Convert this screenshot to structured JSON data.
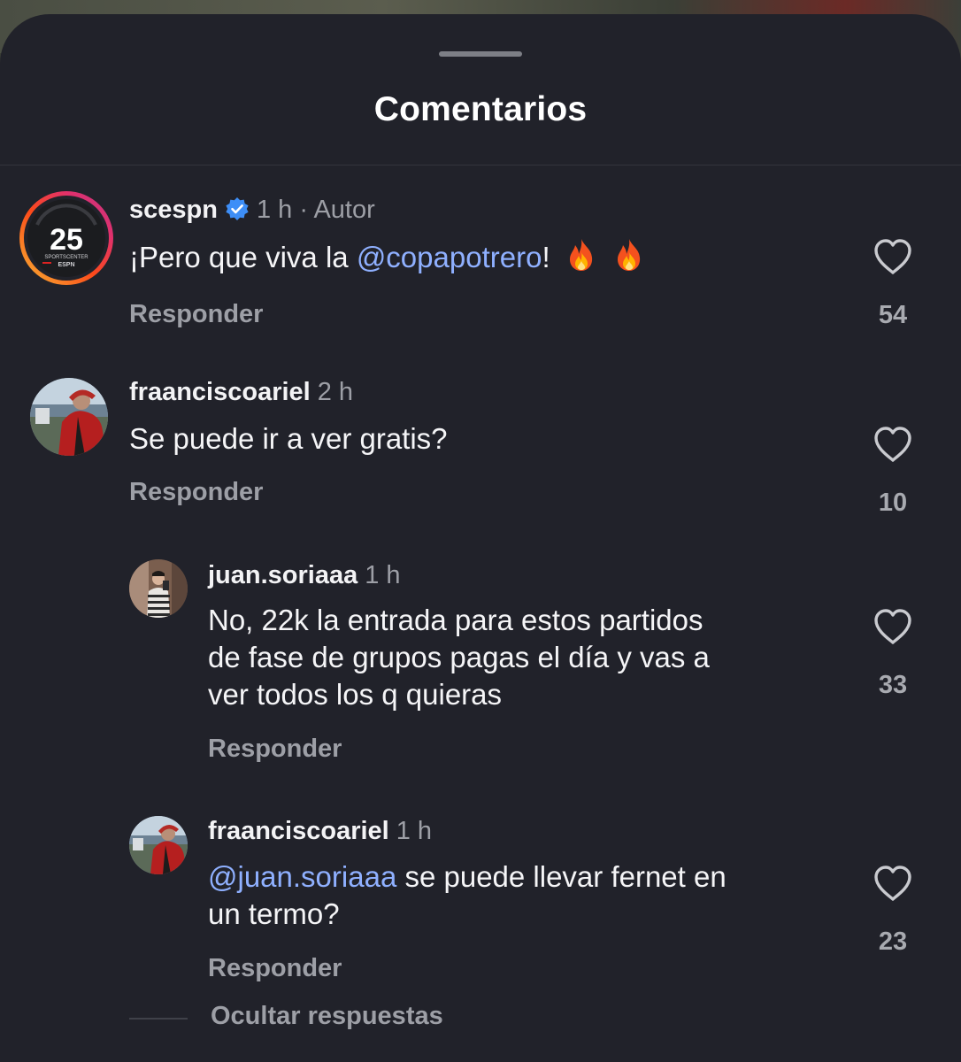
{
  "sheet": {
    "title": "Comentarios",
    "hide_replies_label": "Ocultar respuestas"
  },
  "comments": [
    {
      "username": "scespn",
      "verified": true,
      "time": "1 h",
      "author_tag": "· Autor",
      "text_prefix": "¡Pero que viva la ",
      "mention": "@copapotrero",
      "text_suffix": "!",
      "emojis": [
        "fire-emoji",
        "fire-emoji"
      ],
      "reply_label": "Responder",
      "likes": "54",
      "avatar": "sportscenter-25-logo"
    },
    {
      "username": "fraanciscoariel",
      "time": "2 h",
      "text": "Se puede ir a ver gratis?",
      "reply_label": "Responder",
      "likes": "10",
      "avatar": "user-photo-red-jacket"
    }
  ],
  "replies": [
    {
      "username": "juan.soriaaa",
      "time": "1 h",
      "lines": [
        "No, 22k la entrada para estos partidos",
        "de fase de grupos pagas el día y vas a",
        "ver todos los q quieras"
      ],
      "reply_label": "Responder",
      "likes": "33",
      "avatar": "user-photo-striped-shirt"
    },
    {
      "username": "fraanciscoariel",
      "time": "1 h",
      "mention": "@juan.soriaaa",
      "line1_suffix": " se puede llevar fernet en",
      "line2": "un termo?",
      "reply_label": "Responder",
      "likes": "23",
      "avatar": "user-photo-red-jacket"
    }
  ],
  "colors": {
    "background": "#21222a",
    "mention": "#8fb0ff",
    "muted": "#9d9fa6",
    "verified": "#3d8ef7"
  }
}
